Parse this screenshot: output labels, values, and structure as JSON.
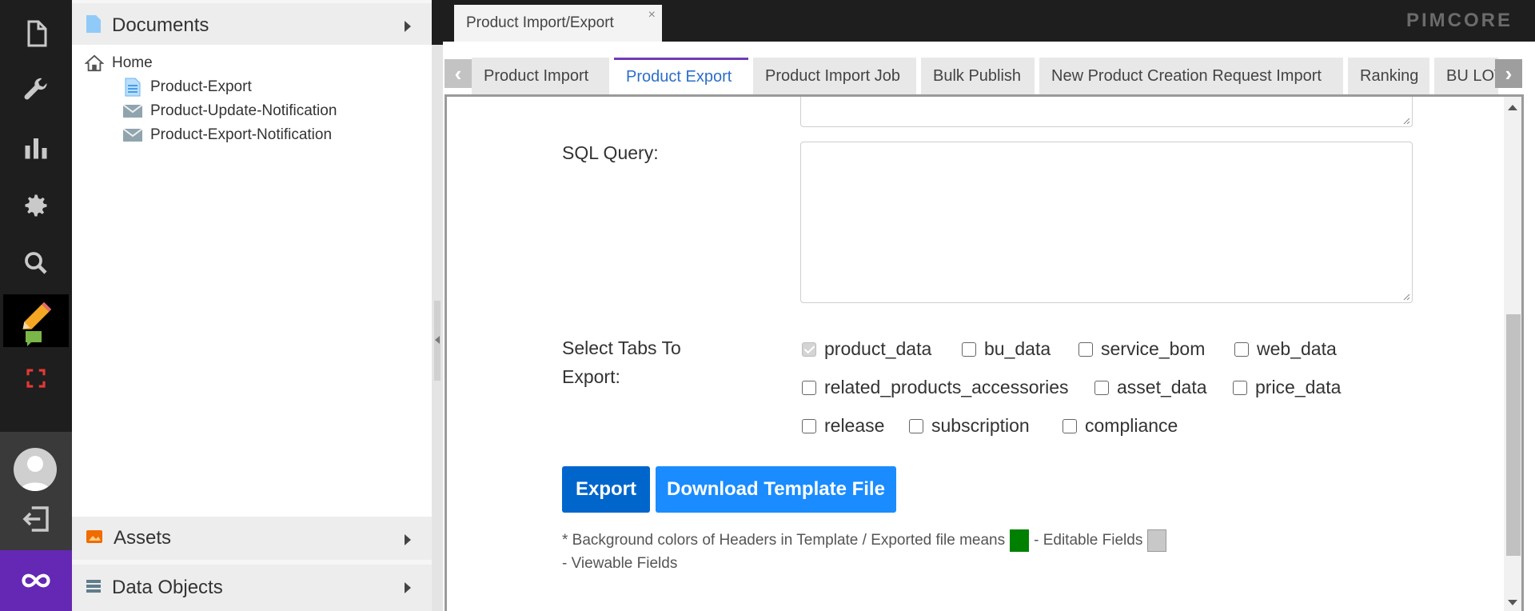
{
  "rail": {
    "icons": [
      "document-icon",
      "wrench-icon",
      "bar-chart-icon",
      "gear-icon",
      "search-icon",
      "pencil-icon",
      "chat-icon",
      "sync-icon",
      "user-avatar-icon",
      "logout-icon",
      "pimcore-brand-icon"
    ]
  },
  "tree": {
    "documents_label": "Documents",
    "assets_label": "Assets",
    "data_objects_label": "Data Objects",
    "nodes": [
      {
        "label": "Home",
        "icon": "home-icon"
      },
      {
        "label": "Product-Export",
        "icon": "page-icon"
      },
      {
        "label": "Product-Update-Notification",
        "icon": "email-icon"
      },
      {
        "label": "Product-Export-Notification",
        "icon": "email-icon"
      }
    ]
  },
  "topbar": {
    "tab_label": "Product Import/Export",
    "close_glyph": "×",
    "logo": "PIMCORE"
  },
  "subtabs": [
    {
      "label": "Product Import",
      "active": false
    },
    {
      "label": "Product Export",
      "active": true
    },
    {
      "label": "Product Import Job",
      "active": false
    },
    {
      "label": "Bulk Publish",
      "active": false
    },
    {
      "label": "New Product Creation Request Import",
      "active": false
    },
    {
      "label": "Ranking",
      "active": false
    },
    {
      "label": "BU LOV",
      "active": false
    }
  ],
  "form": {
    "sql_label": "SQL Query:",
    "sql_value": "",
    "select_tabs_label": "Select Tabs To Export:",
    "tabs": [
      {
        "label": "product_data",
        "checked": true,
        "disabled": true
      },
      {
        "label": "bu_data",
        "checked": false
      },
      {
        "label": "service_bom",
        "checked": false
      },
      {
        "label": "web_data",
        "checked": false
      },
      {
        "label": "related_products_accessories",
        "checked": false
      },
      {
        "label": "asset_data",
        "checked": false
      },
      {
        "label": "price_data",
        "checked": false
      },
      {
        "label": "release",
        "checked": false
      },
      {
        "label": "subscription",
        "checked": false
      },
      {
        "label": "compliance",
        "checked": false
      }
    ],
    "export_button": "Export",
    "download_button": "Download Template File",
    "note_part1": "* Background colors of Headers in Template / Exported file means",
    "note_part2": "- Editable Fields",
    "note_part3": "- Viewable Fields"
  },
  "colors": {
    "export_button": "#0066cc",
    "download_button": "#1a8cff",
    "editable_swatch": "#008000",
    "viewable_swatch": "#c8c8c8",
    "brand": "#6428b4",
    "active_tab_text": "#2b6fc9",
    "active_tab_border": "#6d3bb8"
  }
}
